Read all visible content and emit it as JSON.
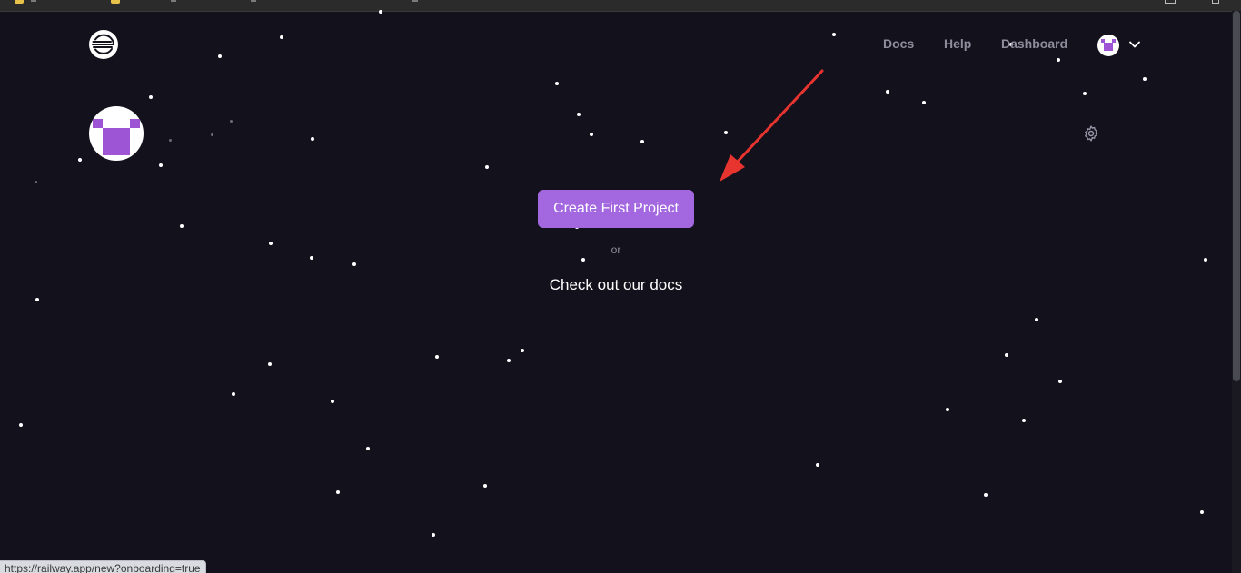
{
  "browser": {
    "status_url": "https://railway.app/new?onboarding=true"
  },
  "header": {
    "logo_icon": "railway-logo-icon",
    "nav": {
      "docs_label": "Docs",
      "help_label": "Help",
      "dashboard_label": "Dashboard"
    },
    "avatar_icon": "user-avatar-icon",
    "menu_icon": "chevron-down-icon"
  },
  "profile": {
    "avatar_icon": "user-avatar-icon",
    "settings_icon": "gear-icon"
  },
  "main": {
    "create_button_label": "Create First Project",
    "or_text": "or",
    "docs_prefix": "Check out our ",
    "docs_link_label": "docs"
  },
  "annotation": {
    "arrow_color": "#e8342f"
  },
  "colors": {
    "background": "#13111c",
    "accent": "#a367e0",
    "nav_text": "#8f8d9c",
    "avatar_purple": "#9d55d6"
  }
}
